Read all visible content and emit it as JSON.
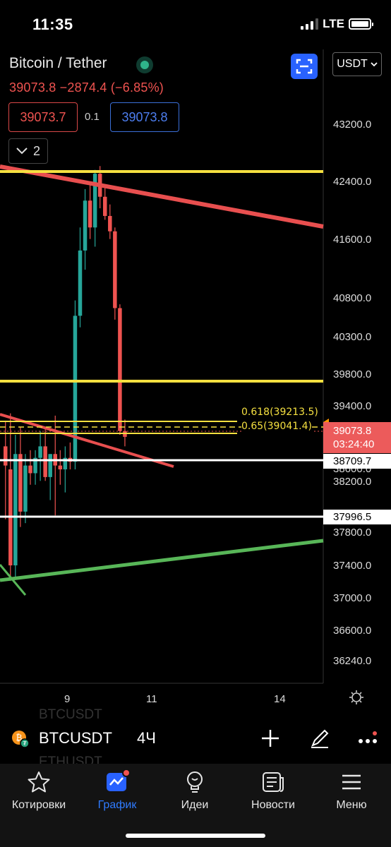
{
  "status_bar": {
    "time": "11:35",
    "network": "LTE"
  },
  "header": {
    "symbol_title": "Bitcoin / Tether",
    "price_change": "39073.8  −2874.4 (−6.85%)",
    "bid": "39073.7",
    "spread": "0.1",
    "ask": "39073.8",
    "collapse_count": "2",
    "currency": "USDT"
  },
  "price_axis": {
    "labels": [
      "43200.0",
      "42400.0",
      "41600.0",
      "40800.0",
      "40300.0",
      "39800.0",
      "39400.0",
      "38600.0",
      "38200.0",
      "37800.0",
      "37400.0",
      "37000.0",
      "36600.0",
      "36240.0"
    ],
    "current_price": "39073.8",
    "countdown": "03:24:40",
    "level_1": "38709.7",
    "level_2": "37996.5"
  },
  "fib_levels": {
    "level_618": "0.618(39213.5)",
    "level_65": "0.65(39041.4)"
  },
  "time_axis": {
    "labels": [
      "9",
      "11",
      "14"
    ]
  },
  "symbol_bar": {
    "ghost_above": "BTCUSDT",
    "symbol": "BTCUSDT",
    "interval": "4Ч",
    "ghost_below": "ETHUSDT"
  },
  "bottom_nav": {
    "items": [
      {
        "label": "Котировки",
        "icon": "star-icon"
      },
      {
        "label": "График",
        "icon": "chart-icon"
      },
      {
        "label": "Идеи",
        "icon": "lightbulb-icon"
      },
      {
        "label": "Новости",
        "icon": "news-icon"
      },
      {
        "label": "Меню",
        "icon": "menu-icon"
      }
    ],
    "active_index": 1
  },
  "colors": {
    "up": "#26a69a",
    "down": "#ef5350",
    "accent": "#2962ff",
    "yellow_line": "#f5e040",
    "green_line": "#4caf50"
  },
  "chart_data": {
    "type": "candlestick",
    "symbol": "BTCUSDT",
    "interval": "4Ч",
    "x_ticks": [
      "9",
      "11",
      "14"
    ],
    "y_ticks": [
      43200.0,
      42400.0,
      41600.0,
      40800.0,
      40300.0,
      39800.0,
      39400.0,
      38600.0,
      38200.0,
      37800.0,
      37400.0,
      37000.0,
      36600.0,
      36240.0
    ],
    "horizontal_levels": [
      42400.0,
      39800.0,
      38709.7,
      37996.5
    ],
    "fib_retracement": [
      {
        "ratio": 0.618,
        "price": 39213.5
      },
      {
        "ratio": 0.65,
        "price": 39041.4
      }
    ],
    "last_price": 39073.8,
    "candles": [
      {
        "o": 38950,
        "h": 39280,
        "l": 38000,
        "c": 38700
      },
      {
        "o": 38650,
        "h": 39380,
        "l": 37200,
        "c": 37400
      },
      {
        "o": 37400,
        "h": 39100,
        "l": 37250,
        "c": 38850
      },
      {
        "o": 38850,
        "h": 39200,
        "l": 37900,
        "c": 38100
      },
      {
        "o": 38100,
        "h": 38850,
        "l": 37950,
        "c": 38700
      },
      {
        "o": 38700,
        "h": 38900,
        "l": 38450,
        "c": 38600
      },
      {
        "o": 38600,
        "h": 38900,
        "l": 38450,
        "c": 38800
      },
      {
        "o": 38800,
        "h": 39150,
        "l": 38500,
        "c": 38950
      },
      {
        "o": 38950,
        "h": 39200,
        "l": 38500,
        "c": 38550
      },
      {
        "o": 38550,
        "h": 38850,
        "l": 38250,
        "c": 38850
      },
      {
        "o": 38850,
        "h": 39350,
        "l": 38050,
        "c": 38700
      },
      {
        "o": 38700,
        "h": 38900,
        "l": 38450,
        "c": 38650
      },
      {
        "o": 38650,
        "h": 38950,
        "l": 38350,
        "c": 38800
      },
      {
        "o": 38800,
        "h": 39000,
        "l": 38650,
        "c": 38750
      },
      {
        "o": 38750,
        "h": 40850,
        "l": 38650,
        "c": 40650
      },
      {
        "o": 40650,
        "h": 41800,
        "l": 40500,
        "c": 41500
      },
      {
        "o": 41500,
        "h": 42300,
        "l": 41250,
        "c": 42150
      },
      {
        "o": 42150,
        "h": 42400,
        "l": 41650,
        "c": 41800
      },
      {
        "o": 41800,
        "h": 42550,
        "l": 41550,
        "c": 42500
      },
      {
        "o": 42500,
        "h": 42600,
        "l": 42050,
        "c": 42200
      },
      {
        "o": 42200,
        "h": 42350,
        "l": 41900,
        "c": 41950
      },
      {
        "o": 41950,
        "h": 42100,
        "l": 41650,
        "c": 41750
      },
      {
        "o": 41750,
        "h": 41800,
        "l": 40600,
        "c": 40750
      },
      {
        "o": 40750,
        "h": 40800,
        "l": 39100,
        "c": 39150
      },
      {
        "o": 39150,
        "h": 39300,
        "l": 38950,
        "c": 39073.8
      }
    ]
  }
}
